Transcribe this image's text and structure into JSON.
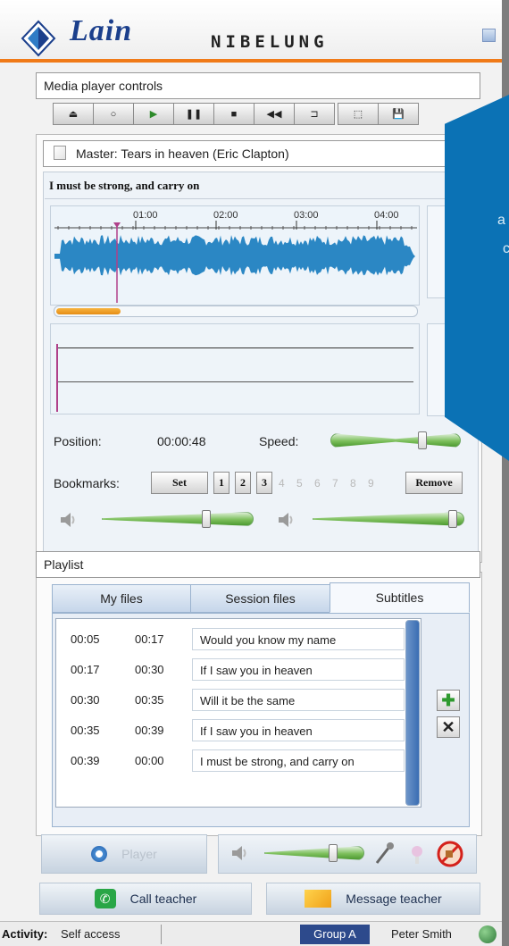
{
  "header": {
    "brand": "Lain",
    "sub_brand": "NIBELUNG"
  },
  "media_controls": {
    "title": "Media player controls",
    "buttons": [
      {
        "name": "eject",
        "glyph": "⏏"
      },
      {
        "name": "record",
        "glyph": "○"
      },
      {
        "name": "play",
        "glyph": "▶"
      },
      {
        "name": "pause",
        "glyph": "❚❚"
      },
      {
        "name": "stop",
        "glyph": "■"
      },
      {
        "name": "rewind",
        "glyph": "◀◀"
      },
      {
        "name": "loop",
        "glyph": "⊐"
      },
      {
        "name": "pointer",
        "glyph": "⬚"
      },
      {
        "name": "save",
        "glyph": "💾"
      }
    ]
  },
  "master": {
    "title": "Master: Tears in heaven (Eric Clapton)",
    "lyric": "I must be strong, and carry on",
    "ticks": [
      "01:00",
      "02:00",
      "03:00",
      "04:00"
    ]
  },
  "position": {
    "label": "Position:",
    "value": "00:00:48"
  },
  "speed": {
    "label": "Speed:",
    "level": 0.72
  },
  "bookmarks": {
    "label": "Bookmarks:",
    "set": "Set",
    "active": [
      "1",
      "2",
      "3"
    ],
    "inactive": [
      "4",
      "5",
      "6",
      "7",
      "8",
      "9"
    ],
    "remove": "Remove"
  },
  "volume": {
    "left_level": 0.7,
    "right_level": 0.95
  },
  "playlist": {
    "title": "Playlist",
    "tabs": [
      "My files",
      "Session files",
      "Subtitles"
    ],
    "active_tab": "Subtitles",
    "rows": [
      {
        "start": "00:05",
        "end": "00:17",
        "text": "Would you know my name"
      },
      {
        "start": "00:17",
        "end": "00:30",
        "text": "If I saw you in heaven"
      },
      {
        "start": "00:30",
        "end": "00:35",
        "text": "Will it be the same"
      },
      {
        "start": "00:35",
        "end": "00:39",
        "text": "If I saw you in heaven"
      },
      {
        "start": "00:39",
        "end": "00:00",
        "text": "I must be strong, and carry on"
      }
    ]
  },
  "bottom": {
    "player": "Player",
    "call": "Call teacher",
    "message": "Message teacher"
  },
  "status": {
    "activity_label": "Activity:",
    "activity_value": "Self access",
    "group": "Group A",
    "user": "Peter Smith"
  },
  "overlay": {
    "line1": "a",
    "line2": "c"
  },
  "colors": {
    "accent": "#f07a18",
    "brand": "#1b3f8c",
    "wave": "#2b87c4",
    "overlay": "#0b72b5"
  }
}
